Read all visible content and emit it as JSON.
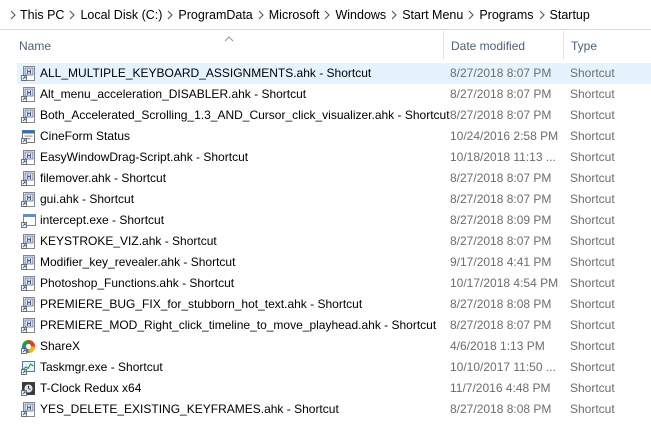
{
  "breadcrumb": [
    "This PC",
    "Local Disk (C:)",
    "ProgramData",
    "Microsoft",
    "Windows",
    "Start Menu",
    "Programs",
    "Startup"
  ],
  "columns": {
    "name": "Name",
    "date": "Date modified",
    "type": "Type"
  },
  "files": [
    {
      "name": "ALL_MULTIPLE_KEYBOARD_ASSIGNMENTS.ahk - Shortcut",
      "date": "8/27/2018 8:07 PM",
      "type": "Shortcut",
      "icon": "ahk-shortcut-icon",
      "selected": true
    },
    {
      "name": "Alt_menu_acceleration_DISABLER.ahk - Shortcut",
      "date": "8/27/2018 8:07 PM",
      "type": "Shortcut",
      "icon": "ahk-shortcut-icon"
    },
    {
      "name": "Both_Accelerated_Scrolling_1.3_AND_Cursor_click_visualizer.ahk - Shortcut",
      "date": "8/27/2018 8:07 PM",
      "type": "Shortcut",
      "icon": "ahk-shortcut-icon"
    },
    {
      "name": "CineForm Status",
      "date": "10/24/2016 2:58 PM",
      "type": "Shortcut",
      "icon": "app-window-icon"
    },
    {
      "name": "EasyWindowDrag-Script.ahk - Shortcut",
      "date": "10/18/2018 11:13 ...",
      "type": "Shortcut",
      "icon": "ahk-shortcut-icon"
    },
    {
      "name": "filemover.ahk - Shortcut",
      "date": "8/27/2018 8:07 PM",
      "type": "Shortcut",
      "icon": "ahk-shortcut-icon"
    },
    {
      "name": "gui.ahk - Shortcut",
      "date": "8/27/2018 8:07 PM",
      "type": "Shortcut",
      "icon": "ahk-shortcut-icon"
    },
    {
      "name": "intercept.exe - Shortcut",
      "date": "8/27/2018 8:09 PM",
      "type": "Shortcut",
      "icon": "exe-shortcut-icon"
    },
    {
      "name": "KEYSTROKE_VIZ.ahk - Shortcut",
      "date": "8/27/2018 8:07 PM",
      "type": "Shortcut",
      "icon": "ahk-shortcut-icon"
    },
    {
      "name": "Modifier_key_revealer.ahk - Shortcut",
      "date": "9/17/2018 4:41 PM",
      "type": "Shortcut",
      "icon": "ahk-shortcut-icon"
    },
    {
      "name": "Photoshop_Functions.ahk - Shortcut",
      "date": "10/17/2018 4:54 PM",
      "type": "Shortcut",
      "icon": "ahk-shortcut-icon"
    },
    {
      "name": "PREMIERE_BUG_FIX_for_stubborn_hot_text.ahk - Shortcut",
      "date": "8/27/2018 8:08 PM",
      "type": "Shortcut",
      "icon": "ahk-shortcut-icon"
    },
    {
      "name": "PREMIERE_MOD_Right_click_timeline_to_move_playhead.ahk - Shortcut",
      "date": "8/27/2018 8:07 PM",
      "type": "Shortcut",
      "icon": "ahk-shortcut-icon"
    },
    {
      "name": "ShareX",
      "date": "4/6/2018 1:13 PM",
      "type": "Shortcut",
      "icon": "sharex-icon"
    },
    {
      "name": "Taskmgr.exe - Shortcut",
      "date": "10/10/2017 11:50 ...",
      "type": "Shortcut",
      "icon": "taskmgr-icon"
    },
    {
      "name": "T-Clock Redux x64",
      "date": "11/7/2016 4:48 PM",
      "type": "Shortcut",
      "icon": "clock-icon"
    },
    {
      "name": "YES_DELETE_EXISTING_KEYFRAMES.ahk - Shortcut",
      "date": "8/27/2018 8:08 PM",
      "type": "Shortcut",
      "icon": "ahk-shortcut-icon"
    }
  ],
  "colors": {
    "selected_row": "#e5f3ff",
    "header_text": "#4c607a",
    "secondary_text": "#6d6d6d"
  }
}
